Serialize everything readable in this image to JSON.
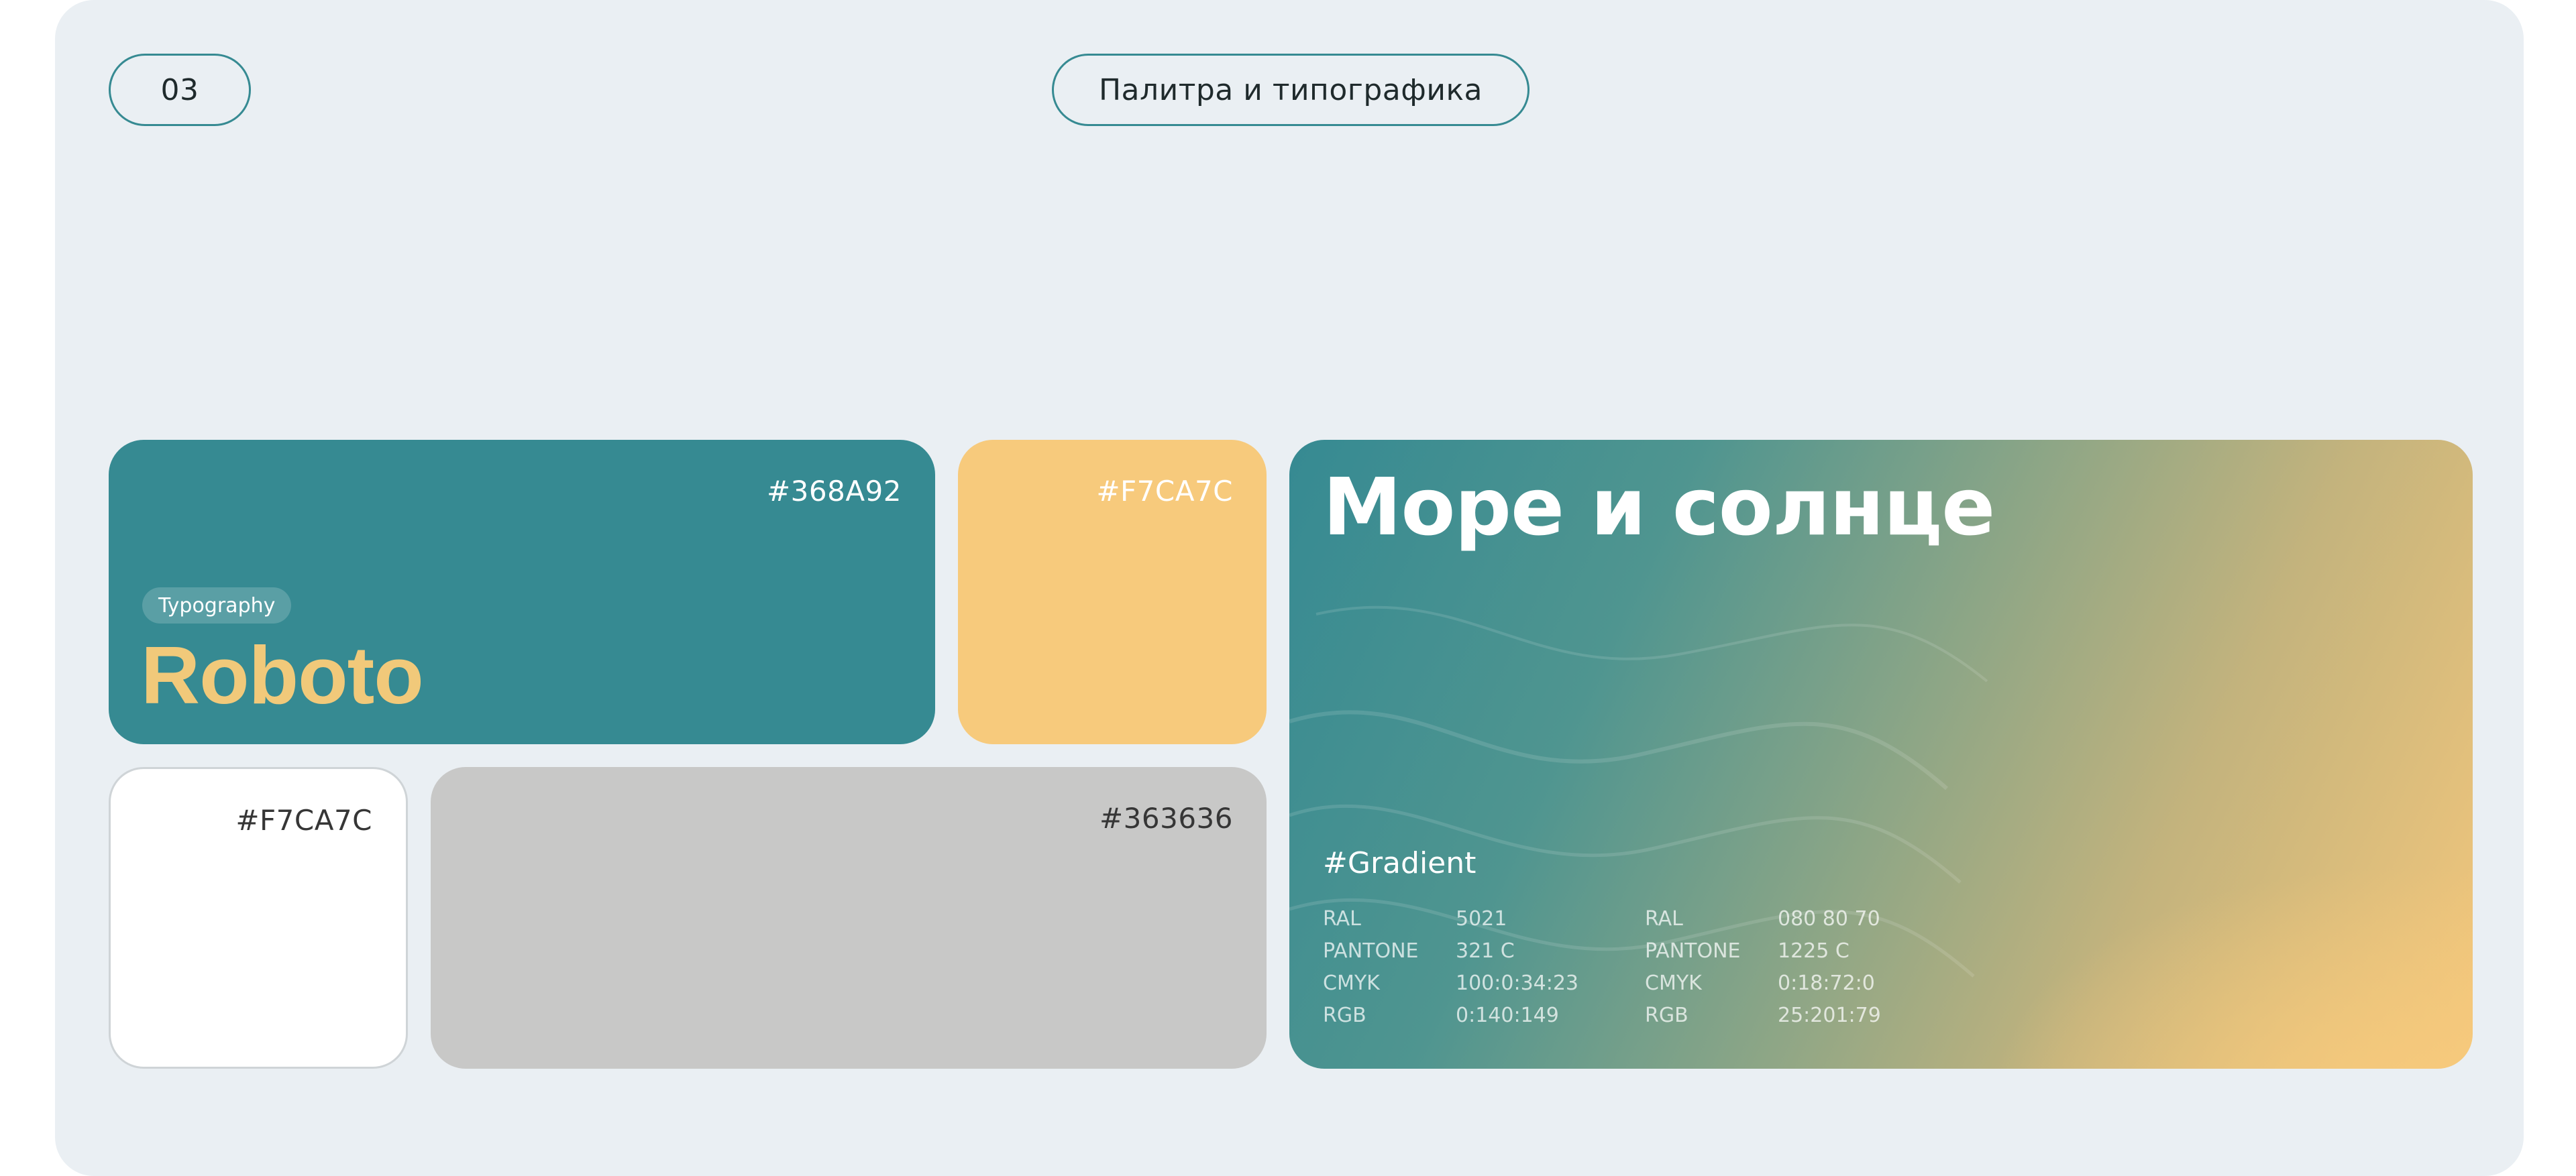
{
  "header": {
    "page_number": "03",
    "section_title": "Палитра и типографика"
  },
  "palette": {
    "primary": {
      "hex_label": "#368A92",
      "color": "#368A92"
    },
    "accent": {
      "hex_label": "#F7CA7C",
      "color": "#F7CA7C"
    },
    "light": {
      "hex_label": "#F7CA7C",
      "color": "#FFFFFF"
    },
    "dark": {
      "hex_label": "#363636",
      "color": "#C8C8C7"
    }
  },
  "typography": {
    "tag": "Typography",
    "font_name": "Roboto"
  },
  "gradient": {
    "title": "Море и солнце",
    "label": "#Gradient",
    "spec_a": [
      {
        "key": "RAL",
        "value": "5021"
      },
      {
        "key": "PANTONE",
        "value": "321 C"
      },
      {
        "key": "CMYK",
        "value": "100:0:34:23"
      },
      {
        "key": "RGB",
        "value": "0:140:149"
      }
    ],
    "spec_b": [
      {
        "key": "RAL",
        "value": "080 80 70"
      },
      {
        "key": "PANTONE",
        "value": "1225 C"
      },
      {
        "key": "CMYK",
        "value": "0:18:72:0"
      },
      {
        "key": "RGB",
        "value": "25:201:79"
      }
    ]
  }
}
